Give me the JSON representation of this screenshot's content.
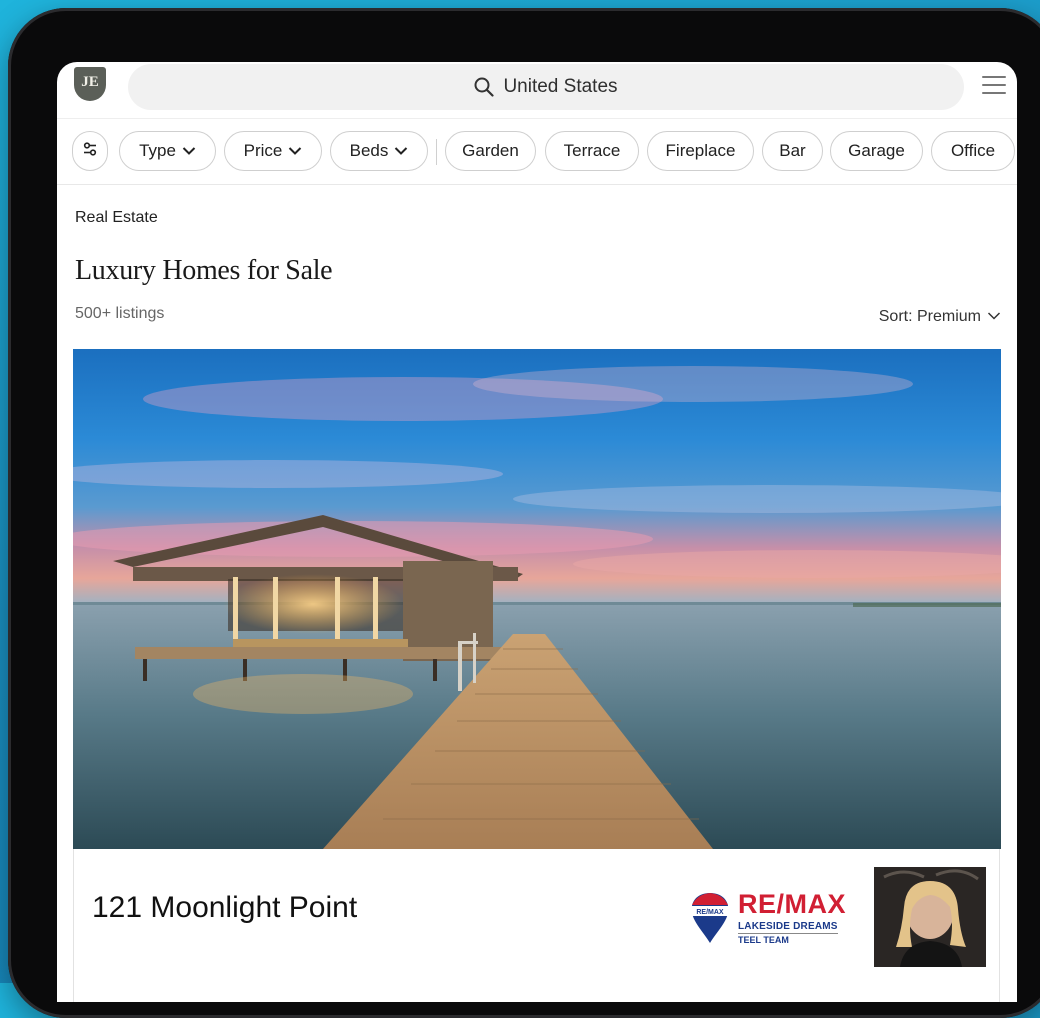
{
  "header": {
    "logo_text": "JE",
    "search_text": "United States",
    "menu_icon": "hamburger-menu-icon"
  },
  "filters": {
    "settings_icon": "filter-settings-icon",
    "dropdowns": [
      {
        "label": "Type"
      },
      {
        "label": "Price"
      },
      {
        "label": "Beds"
      }
    ],
    "features": [
      "Garden",
      "Terrace",
      "Fireplace",
      "Bar",
      "Garage",
      "Office"
    ]
  },
  "page": {
    "breadcrumb": "Real Estate",
    "title": "Luxury Homes for Sale",
    "listing_count": "500+ listings",
    "sort_label": "Sort: Premium"
  },
  "listing": {
    "address": "121 Moonlight Point",
    "brand": {
      "name": "RE/MAX",
      "line1": "LAKESIDE DREAMS",
      "line2": "TEEL TEAM",
      "balloon_text": "RE/MAX"
    },
    "image_desc_icon": "boathouse-pier-photo",
    "agent_photo": "agent-portrait-photo"
  },
  "colors": {
    "brand_red": "#d11f33",
    "brand_blue": "#1b3a8a",
    "logo_bg": "#5b5f58",
    "background": "#1a8fc0"
  }
}
